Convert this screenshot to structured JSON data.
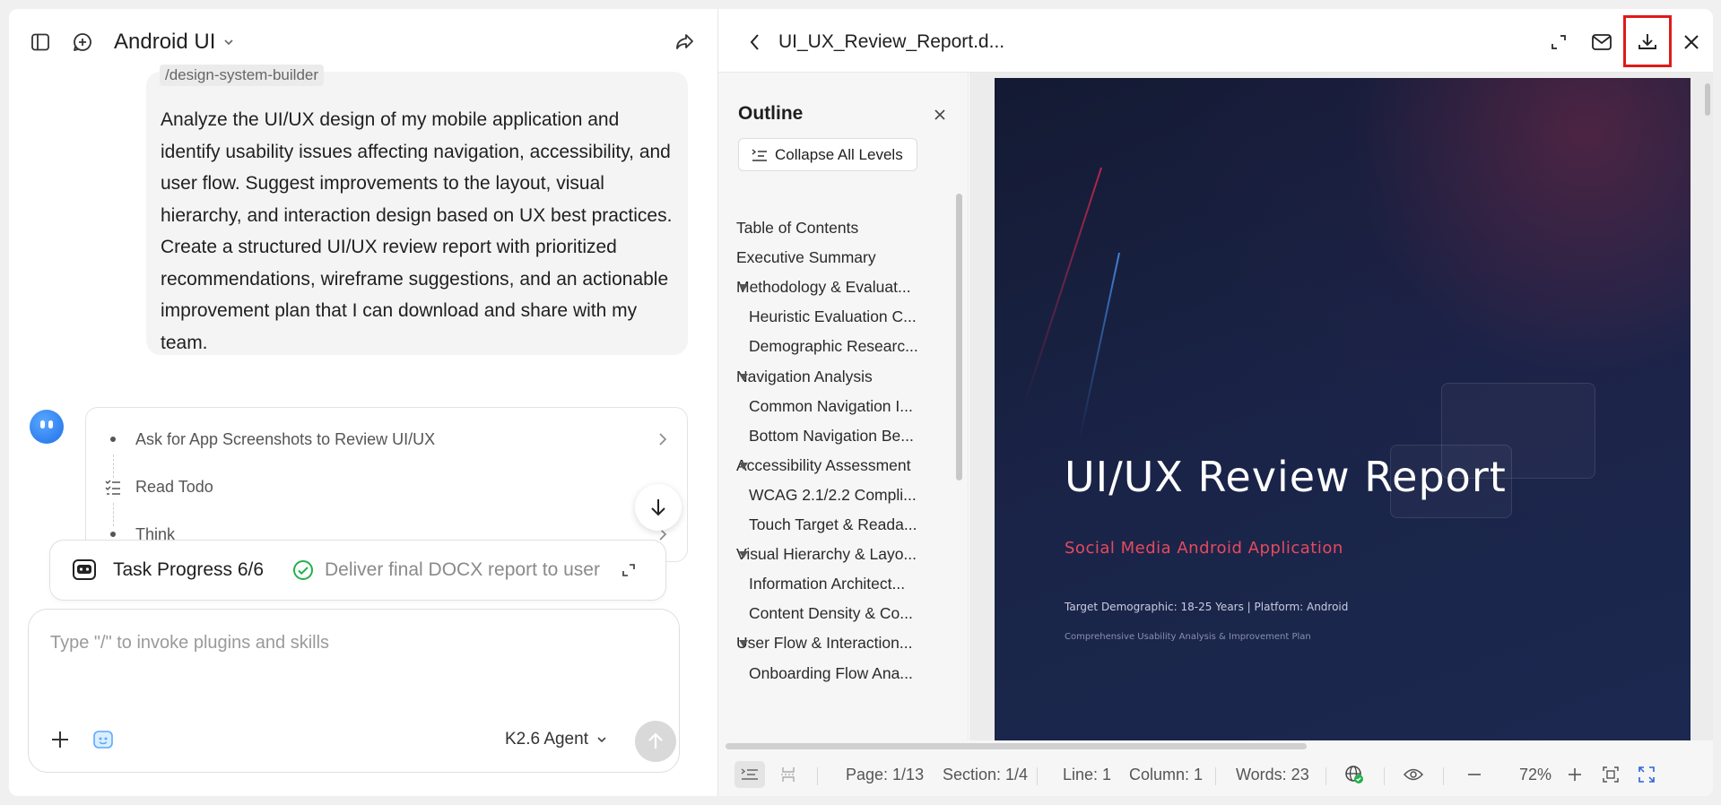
{
  "left": {
    "app_title": "Android UI",
    "command_chip": "/design-system-builder",
    "user_message": "Analyze the UI/UX design of my mobile application and identify usability issues affecting navigation, accessibility, and user flow. Suggest improvements to the layout, visual hierarchy, and interaction design based on UX best practices. Create a structured UI/UX review report with prioritized recommendations, wireframe suggestions, and an actionable improvement plan that I can download and share with my team.",
    "steps": [
      {
        "label": "Ask for App Screenshots to Review UI/UX"
      },
      {
        "label": "Read Todo"
      },
      {
        "label": "Think"
      }
    ],
    "task_progress": {
      "label": "Task Progress 6/6",
      "current_item": "Deliver final DOCX report to user"
    },
    "composer": {
      "placeholder": "Type \"/\" to invoke plugins and skills",
      "agent": "K2.6 Agent"
    }
  },
  "right": {
    "doc_title": "UI_UX_Review_Report.d...",
    "outline": {
      "title": "Outline",
      "collapse_label": "Collapse All Levels",
      "items": [
        {
          "label": "Table of Contents",
          "level": 1,
          "toggle": false
        },
        {
          "label": "Executive Summary",
          "level": 1,
          "toggle": false
        },
        {
          "label": "Methodology & Evaluat...",
          "level": 1,
          "toggle": true
        },
        {
          "label": "Heuristic Evaluation C...",
          "level": 2,
          "toggle": false
        },
        {
          "label": "Demographic Researc...",
          "level": 2,
          "toggle": false
        },
        {
          "label": "Navigation Analysis",
          "level": 1,
          "toggle": true
        },
        {
          "label": "Common Navigation I...",
          "level": 2,
          "toggle": false
        },
        {
          "label": "Bottom Navigation Be...",
          "level": 2,
          "toggle": false
        },
        {
          "label": "Accessibility Assessment",
          "level": 1,
          "toggle": true
        },
        {
          "label": "WCAG 2.1/2.2 Compli...",
          "level": 2,
          "toggle": false
        },
        {
          "label": "Touch Target & Reada...",
          "level": 2,
          "toggle": false
        },
        {
          "label": "Visual Hierarchy & Layo...",
          "level": 1,
          "toggle": true
        },
        {
          "label": "Information Architect...",
          "level": 2,
          "toggle": false
        },
        {
          "label": "Content Density & Co...",
          "level": 2,
          "toggle": false
        },
        {
          "label": "User Flow & Interaction...",
          "level": 1,
          "toggle": true
        },
        {
          "label": "Onboarding Flow Ana...",
          "level": 2,
          "toggle": false
        }
      ]
    },
    "cover": {
      "title": "UI/UX Review Report",
      "subtitle": "Social Media Android Application",
      "meta": "Target Demographic: 18-25 Years | Platform: Android",
      "desc": "Comprehensive Usability Analysis & Improvement Plan"
    },
    "status": {
      "page": "Page: 1/13",
      "section": "Section: 1/4",
      "line": "Line: 1",
      "column": "Column: 1",
      "words": "Words: 23",
      "zoom": "72%"
    }
  },
  "colors": {
    "accent_red": "#e01a1a",
    "success_green": "#22b14c",
    "cover_subtitle": "#e64a5e"
  }
}
